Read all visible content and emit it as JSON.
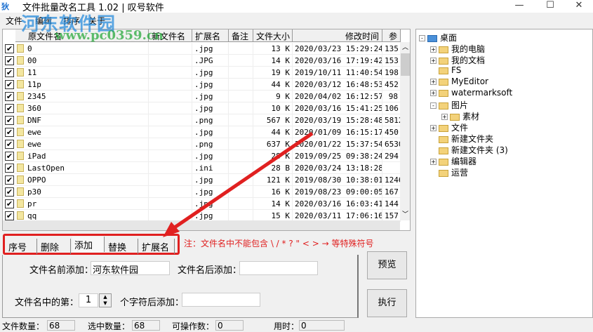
{
  "title": "文件批量改名工具 1.02 | 叹号软件",
  "window_controls": [
    "—",
    "☐",
    "✕"
  ],
  "menu": [
    "文件",
    "编辑",
    "排序",
    "关于"
  ],
  "watermark": {
    "name": "河东软件园",
    "url": "www.pc0359.cn"
  },
  "table": {
    "columns": [
      "原文件名",
      "新文件名",
      "扩展名",
      "备注",
      "文件大小",
      "修改时间",
      "参"
    ],
    "rows": [
      {
        "name": "0",
        "ext": ".jpg",
        "size": "13 K",
        "mtime": "2020/03/23  15:29:24",
        "extra": "135"
      },
      {
        "name": "00",
        "ext": ".JPG",
        "size": "14 K",
        "mtime": "2020/03/16  17:19:42",
        "extra": "153"
      },
      {
        "name": "11",
        "ext": ".jpg",
        "size": "19 K",
        "mtime": "2019/10/11  11:40:54",
        "extra": "198"
      },
      {
        "name": "11p",
        "ext": ".jpg",
        "size": "44 K",
        "mtime": "2020/03/12  16:48:53",
        "extra": "452"
      },
      {
        "name": "2345",
        "ext": ".jpg",
        "size": "9 K",
        "mtime": "2020/04/02  16:12:57",
        "extra": "98"
      },
      {
        "name": "360",
        "ext": ".jpg",
        "size": "10 K",
        "mtime": "2020/03/16  15:41:25",
        "extra": "106"
      },
      {
        "name": "DNF",
        "ext": ".png",
        "size": "567 K",
        "mtime": "2020/03/19  15:28:48",
        "extra": "5812"
      },
      {
        "name": "ewe",
        "ext": ".jpg",
        "size": "44 K",
        "mtime": "2020/01/09  16:15:17",
        "extra": "450"
      },
      {
        "name": "ewe",
        "ext": ".png",
        "size": "637 K",
        "mtime": "2020/01/22  15:37:54",
        "extra": "6530"
      },
      {
        "name": "iPad",
        "ext": ".jpg",
        "size": "28 K",
        "mtime": "2019/09/25  09:38:24",
        "extra": "294"
      },
      {
        "name": "LastOpen",
        "ext": ".ini",
        "size": "28 B",
        "mtime": "2020/03/24  13:18:28",
        "extra": ""
      },
      {
        "name": "OPPO",
        "ext": ".jpg",
        "size": "121 K",
        "mtime": "2019/08/30  10:38:01",
        "extra": "1246"
      },
      {
        "name": "p30",
        "ext": ".jpg",
        "size": "16 K",
        "mtime": "2019/08/23  09:00:05",
        "extra": "167"
      },
      {
        "name": "pr",
        "ext": ".jpg",
        "size": "14 K",
        "mtime": "2020/03/16  16:03:41",
        "extra": "144"
      },
      {
        "name": "qq",
        "ext": ".jpg",
        "size": "15 K",
        "mtime": "2020/03/11  17:06:16",
        "extra": "157"
      }
    ]
  },
  "tree": [
    {
      "label": "桌面",
      "level": 0,
      "exp": "-"
    },
    {
      "label": "我的电脑",
      "level": 1,
      "exp": "+"
    },
    {
      "label": "我的文档",
      "level": 1,
      "exp": "+"
    },
    {
      "label": "FS",
      "level": 1,
      "exp": ""
    },
    {
      "label": "MyEditor",
      "level": 1,
      "exp": "+"
    },
    {
      "label": "watermarksoft",
      "level": 1,
      "exp": "+"
    },
    {
      "label": "图片",
      "level": 1,
      "exp": "-"
    },
    {
      "label": "素材",
      "level": 2,
      "exp": "+"
    },
    {
      "label": "文件",
      "level": 1,
      "exp": "+"
    },
    {
      "label": "新建文件夹",
      "level": 1,
      "exp": ""
    },
    {
      "label": "新建文件夹 (3)",
      "level": 1,
      "exp": ""
    },
    {
      "label": "编辑器",
      "level": 1,
      "exp": "+"
    },
    {
      "label": "运营",
      "level": 1,
      "exp": ""
    }
  ],
  "tabs": [
    "序号",
    "删除",
    "添加",
    "替换",
    "扩展名"
  ],
  "active_tab": 2,
  "note": "注：文件名中不能包含 \\ /  * ? \" < > → 等特殊符号",
  "add_panel": {
    "prefix_label": "文件名前添加：",
    "prefix_value": "河东软件园",
    "suffix_label": "文件名后添加：",
    "suffix_value": "",
    "pos_label": "文件名中的第：",
    "pos_value": "1",
    "after_label": "个字符后添加：",
    "after_value": ""
  },
  "buttons": {
    "preview": "预览",
    "execute": "执行"
  },
  "status": {
    "file_count_label": "文件数量：",
    "file_count": "68",
    "selected_label": "选中数量：",
    "selected": "68",
    "operable_label": "可操作数：",
    "operable": "0",
    "time_label": "用时：",
    "time": "0"
  },
  "annotation_color": "#e02020"
}
